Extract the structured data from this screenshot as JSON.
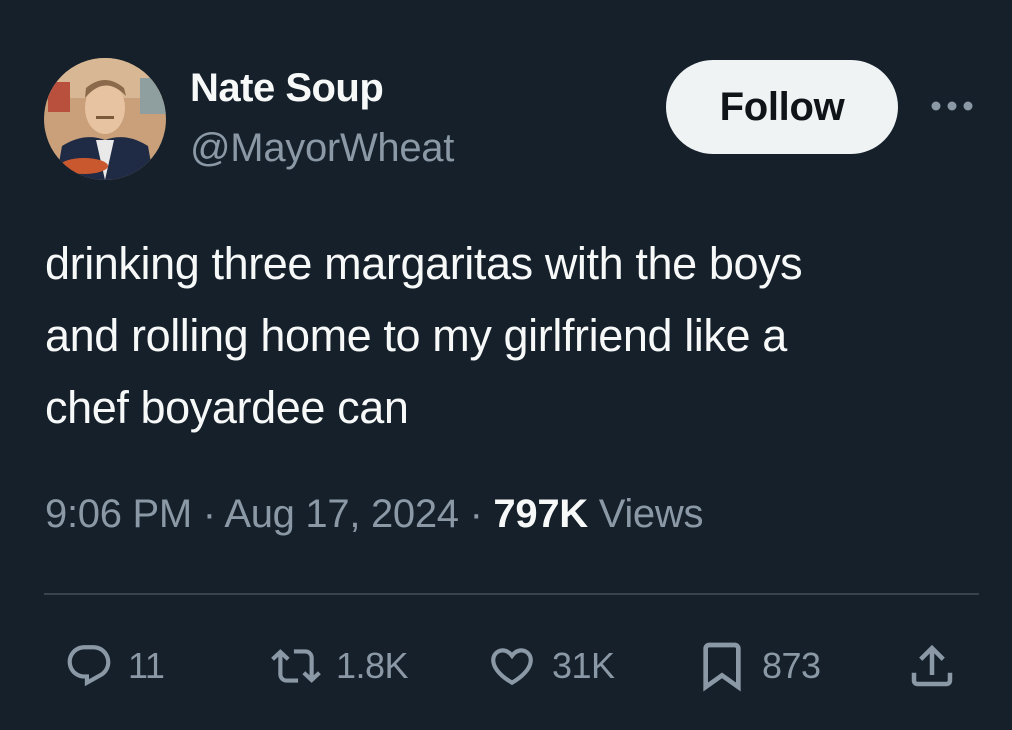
{
  "author": {
    "display_name": "Nate Soup",
    "handle": "@MayorWheat"
  },
  "follow_label": "Follow",
  "tweet": {
    "lines": [
      "drinking three margaritas with the boys",
      "and rolling home to my girlfriend like a",
      "chef boyardee can"
    ]
  },
  "meta": {
    "time": "9:06 PM",
    "separator": "·",
    "date": "Aug 17, 2024",
    "views_count": "797K",
    "views_label": "Views"
  },
  "actions": {
    "replies": "11",
    "reposts": "1.8K",
    "likes": "31K",
    "bookmarks": "873"
  },
  "icons": {
    "reply": "reply-icon",
    "repost": "repost-icon",
    "like": "heart-icon",
    "bookmark": "bookmark-icon",
    "share": "share-icon",
    "more": "more-icon"
  },
  "colors": {
    "background": "#15202b",
    "primary_text": "#f7f9f9",
    "secondary_text": "#8b98a5",
    "divider": "#38444d",
    "follow_bg": "#eff3f4",
    "follow_text": "#0f1419"
  }
}
